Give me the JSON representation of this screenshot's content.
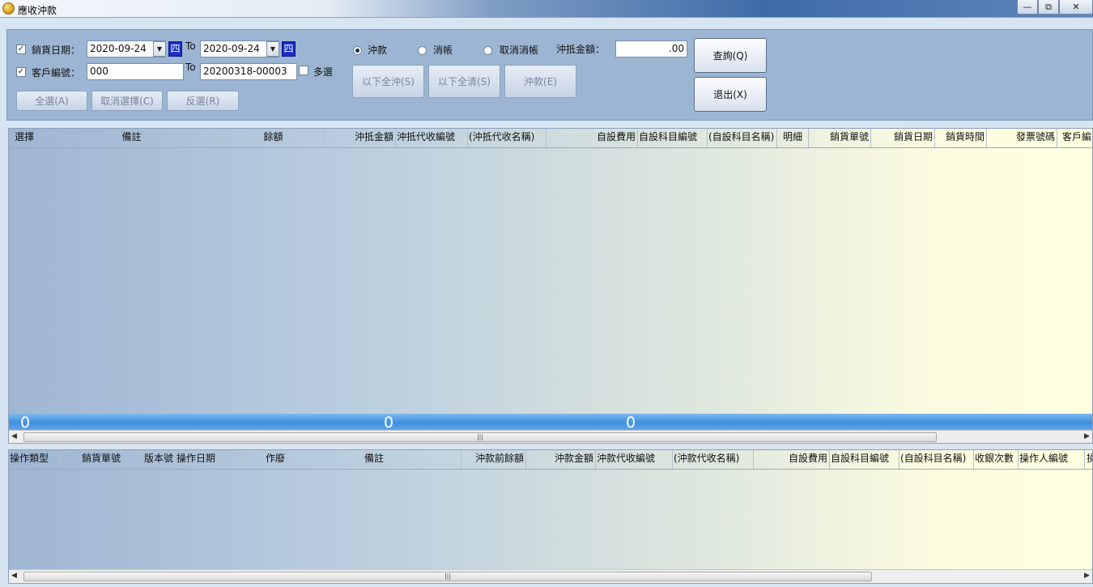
{
  "window": {
    "title": "應收沖款",
    "min_glyph": "—",
    "max_glyph": "⧉",
    "close_glyph": "✕"
  },
  "filters": {
    "sales_date_label": "銷貨日期：",
    "sales_date_from": "2020-09-24",
    "sales_date_to": "2020-09-24",
    "weekday_from": "四",
    "weekday_to": "四",
    "to_label": "To",
    "customer_label": "客戶編號：",
    "customer_from": "000",
    "customer_to": "20200318-00003",
    "multi_select_label": "多選",
    "check_mark": "✓",
    "dropdown_glyph": "▼"
  },
  "mode": {
    "options": [
      "沖款",
      "消帳",
      "取消消帳"
    ],
    "selected": "沖款"
  },
  "offset": {
    "label": "沖抵金額：",
    "value": ".00"
  },
  "buttons": {
    "select_all": "全選(A)",
    "deselect": "取消選擇(C)",
    "invert": "反選(R)",
    "offset_all_below": "以下全沖(S)",
    "clear_all_below": "以下全清(S)",
    "apply_offset": "沖款(E)",
    "query": "查詢(Q)",
    "exit": "退出(X)"
  },
  "top_grid": {
    "columns": [
      "選擇",
      "備註",
      "餘額",
      "沖抵金額",
      "沖抵代收編號",
      "(沖抵代收名稱)",
      "自設費用",
      "自設科目編號",
      "(自設科目名稱)",
      "明細",
      "銷貨單號",
      "銷貨日期",
      "銷貨時間",
      "發票號碼",
      "客戶編"
    ],
    "totals": [
      "0",
      "0",
      "0"
    ]
  },
  "bottom_grid": {
    "columns": [
      "操作類型",
      "銷貨單號",
      "版本號",
      "操作日期",
      "作廢",
      "備註",
      "沖款前餘額",
      "沖款金額",
      "沖款代收編號",
      "(沖款代收名稱)",
      "自設費用",
      "自設科目編號",
      "(自設科目名稱)",
      "收銀次數",
      "操作人編號",
      "操"
    ]
  },
  "scroll": {
    "left_arrow": "◀",
    "right_arrow": "▶",
    "thumb_grip": "|||"
  }
}
